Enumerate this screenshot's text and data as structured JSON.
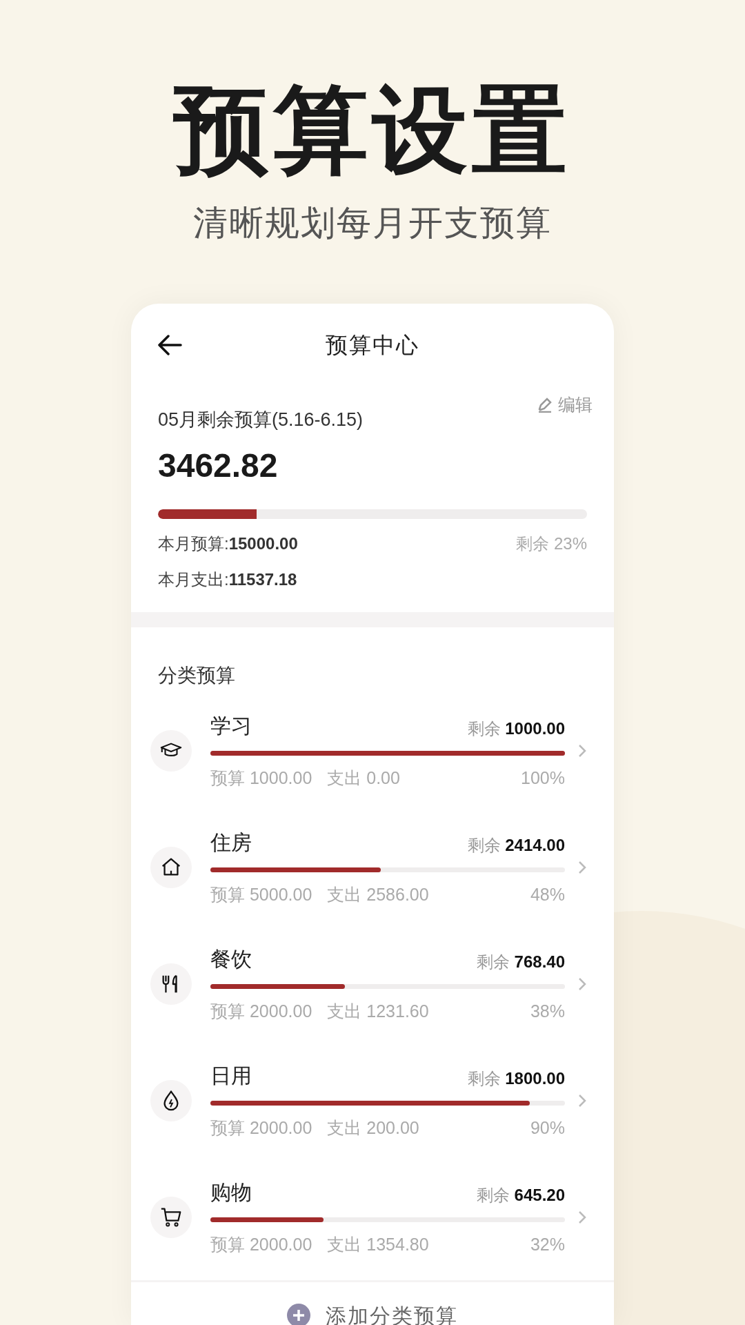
{
  "headline": "预算设置",
  "subheadline": "清晰规划每月开支预算",
  "nav": {
    "title": "预算中心"
  },
  "summary": {
    "period_label": "05月剩余预算(5.16-6.15)",
    "edit": "编辑",
    "amount": "3462.82",
    "level": 0.23,
    "budget_label": "本月预算:",
    "budget": "15000.00",
    "spent_label": "本月支出:",
    "spent": "11537.18",
    "remaining_percent": "剩余 23%"
  },
  "categories_title": "分类预算",
  "categories": [
    {
      "name": "学习",
      "remaining_label": "剩余",
      "remaining": "1000.00",
      "level": 1.0,
      "budget": "预算 1000.00",
      "spent": "支出 0.00",
      "percent": "100%"
    },
    {
      "name": "住房",
      "remaining_label": "剩余",
      "remaining": "2414.00",
      "level": 0.48,
      "budget": "预算 5000.00",
      "spent": "支出 2586.00",
      "percent": "48%"
    },
    {
      "name": "餐饮",
      "remaining_label": "剩余",
      "remaining": "768.40",
      "level": 0.38,
      "budget": "预算 2000.00",
      "spent": "支出 1231.60",
      "percent": "38%"
    },
    {
      "name": "日用",
      "remaining_label": "剩余",
      "remaining": "1800.00",
      "level": 0.9,
      "budget": "预算 2000.00",
      "spent": "支出 200.00",
      "percent": "90%"
    },
    {
      "name": "购物",
      "remaining_label": "剩余",
      "remaining": "645.20",
      "level": 0.32,
      "budget": "预算 2000.00",
      "spent": "支出 1354.80",
      "percent": "32%"
    }
  ],
  "add_button": "添加分类预算"
}
